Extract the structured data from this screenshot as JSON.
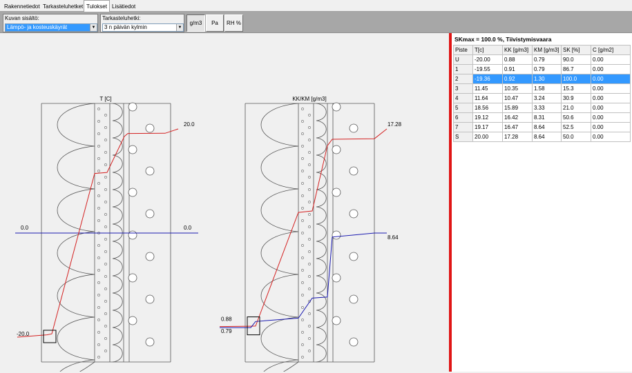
{
  "tabs": [
    {
      "label": "Rakennetiedot"
    },
    {
      "label": "Tarkasteluhetket"
    },
    {
      "label": "Tulokset"
    },
    {
      "label": "Lisätiedot"
    }
  ],
  "toolbar": {
    "content_label": "Kuvan sisältö:",
    "content_value": "Lämpö- ja kosteuskäyrät",
    "moment_label": "Tarkasteluhetki:",
    "moment_value": "3 n päivän kylmin",
    "btn_gm3": "g/m3",
    "btn_pa": "Pa",
    "btn_rh": "RH %"
  },
  "colors": {
    "temperature_line": "#d42020",
    "km_line": "#1a1ab0",
    "zero_line": "#1a1ab0",
    "selection": "#3399ff",
    "divider": "#e01515"
  },
  "chart_data": [
    {
      "type": "line",
      "title": "T [C]",
      "series": [
        {
          "values": [
            -20.0,
            -19.55,
            -19.36,
            11.45,
            11.64,
            18.56,
            19.12,
            19.17,
            20.0
          ]
        }
      ],
      "reference_line": 0.0,
      "annotations": {
        "left_value": "-20.0",
        "right_value": "20.0",
        "zero_left": "0.0",
        "zero_right": "0.0"
      }
    },
    {
      "type": "line",
      "title": "KK/KM [g/m3]",
      "series": [
        {
          "values": [
            0.88,
            0.91,
            0.92,
            10.35,
            10.47,
            15.89,
            16.42,
            16.47,
            17.28
          ]
        },
        {
          "values": [
            0.79,
            0.79,
            1.3,
            1.58,
            3.24,
            3.33,
            8.31,
            8.64,
            8.64
          ]
        }
      ],
      "annotations": {
        "kk_left": "0.88",
        "km_left": "0.79",
        "kk_right": "17.28",
        "km_right": "8.64"
      }
    }
  ],
  "results": {
    "summary": "SKmax = 100.0 %, Tiivistymisvaara",
    "columns": [
      "Piste",
      "T[c]",
      "KK [g/m3]",
      "KM [g/m3]",
      "SK [%]",
      "C [g/m2]"
    ],
    "rows": [
      [
        "U",
        "-20.00",
        "0.88",
        "0.79",
        "90.0",
        "0.00"
      ],
      [
        "1",
        "-19.55",
        "0.91",
        "0.79",
        "86.7",
        "0.00"
      ],
      [
        "2",
        "-19.36",
        "0.92",
        "1.30",
        "100.0",
        "0.00"
      ],
      [
        "3",
        "11.45",
        "10.35",
        "1.58",
        "15.3",
        "0.00"
      ],
      [
        "4",
        "11.64",
        "10.47",
        "3.24",
        "30.9",
        "0.00"
      ],
      [
        "5",
        "18.56",
        "15.89",
        "3.33",
        "21.0",
        "0.00"
      ],
      [
        "6",
        "19.12",
        "16.42",
        "8.31",
        "50.6",
        "0.00"
      ],
      [
        "7",
        "19.17",
        "16.47",
        "8.64",
        "52.5",
        "0.00"
      ],
      [
        "S",
        "20.00",
        "17.28",
        "8.64",
        "50.0",
        "0.00"
      ]
    ],
    "selected_row": 2
  }
}
